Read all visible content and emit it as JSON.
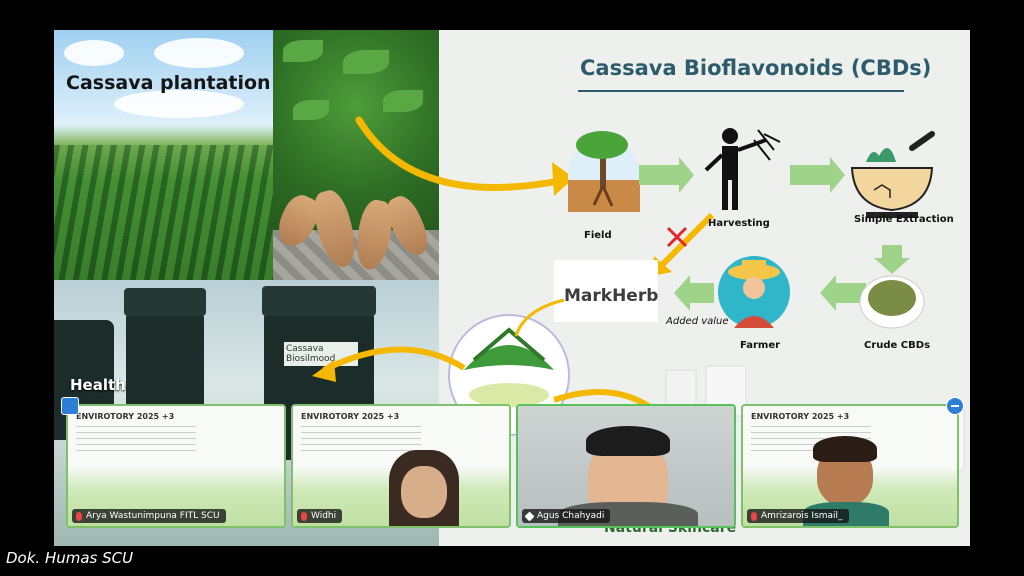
{
  "slide": {
    "title": "Cassava Bioflavonoids (CBDs)",
    "photo_label": "Cassava plantation",
    "health_label": "Health",
    "bottle_label": "Cassava Biosilmood",
    "partner_logo": "MarkHerb",
    "steps": {
      "field": "Field",
      "harvesting": "Harvesting",
      "extraction": "Simple Extraction",
      "crude": "Crude CBDs",
      "farmer": "Farmer",
      "added_value": "Added value"
    },
    "bottom_text": "Natural Skincare"
  },
  "participants": [
    {
      "name": "Arya Wastunimpuna FITL SCU",
      "thumb_title": "ENVIROTORY 2025 +3"
    },
    {
      "name": "Widhi",
      "thumb_title": "ENVIROTORY 2025 +3"
    },
    {
      "name": "Agus Chahyadi",
      "thumb_title": ""
    },
    {
      "name": "Amrizarois Ismail_",
      "thumb_title": "ENVIROTORY 2025 +3"
    }
  ],
  "caption": "Dok. Humas SCU",
  "colors": {
    "title": "#2d5b6b",
    "arrow_green": "#9fd38a",
    "arrow_yellow": "#f5b800",
    "active_border": "#57c25a"
  },
  "icons": {
    "left_corner": "participants-icon",
    "right_corner": "minimize-icon"
  }
}
